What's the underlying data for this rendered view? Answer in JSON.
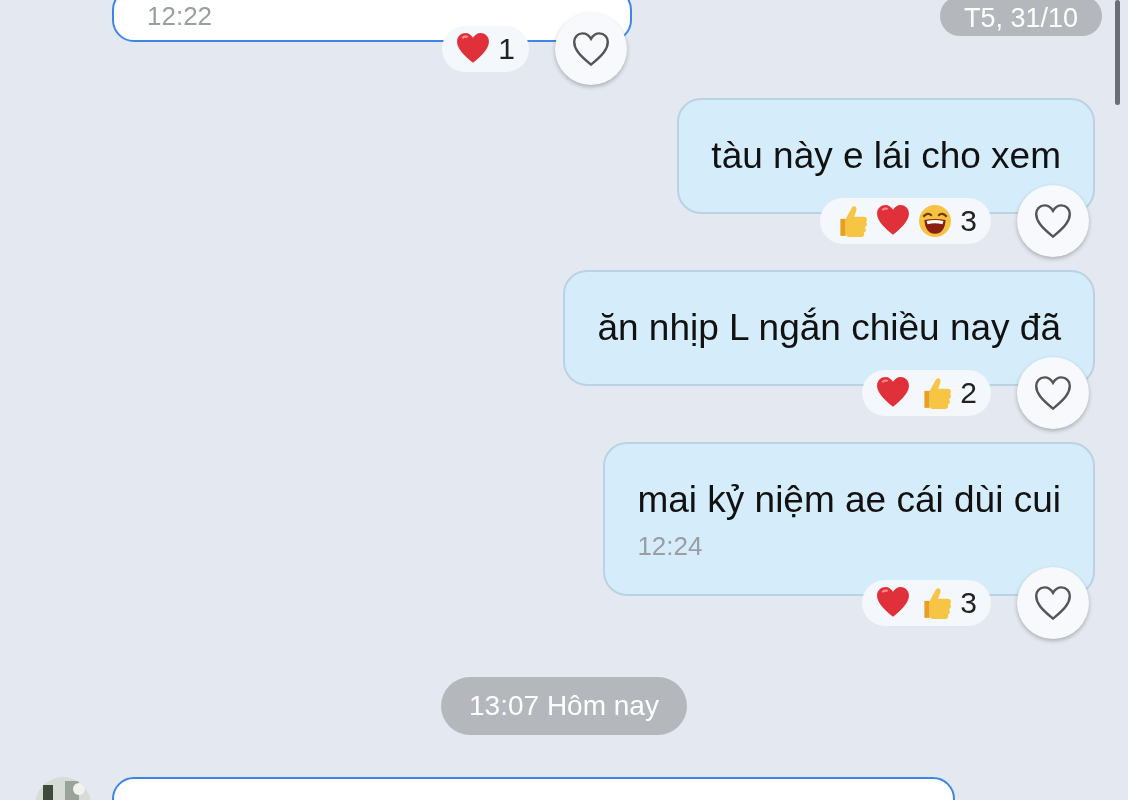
{
  "sticky_date": "T5, 31/10",
  "items": [
    {
      "kind": "message",
      "outgoing": false,
      "time": "12:22",
      "reactions": [
        {
          "kind": "heart"
        }
      ],
      "reaction_count": "1",
      "liked": false
    },
    {
      "kind": "message",
      "outgoing": true,
      "text": "tàu này e lái cho xem",
      "reactions": [
        {
          "kind": "thumbs_up"
        },
        {
          "kind": "heart"
        },
        {
          "kind": "laugh"
        }
      ],
      "reaction_count": "3",
      "liked": false
    },
    {
      "kind": "message",
      "outgoing": true,
      "text": "ăn nhịp L ngắn chiều nay đã",
      "reactions": [
        {
          "kind": "heart"
        },
        {
          "kind": "thumbs_up"
        }
      ],
      "reaction_count": "2",
      "liked": false
    },
    {
      "kind": "message",
      "outgoing": true,
      "text": "mai kỷ niệm ae cái dùi cui",
      "time": "12:24",
      "reactions": [
        {
          "kind": "heart"
        },
        {
          "kind": "thumbs_up"
        }
      ],
      "reaction_count": "3",
      "liked": false
    },
    {
      "kind": "date",
      "text": "13:07 Hôm nay"
    },
    {
      "kind": "message",
      "outgoing": false,
      "avatar": true
    }
  ]
}
